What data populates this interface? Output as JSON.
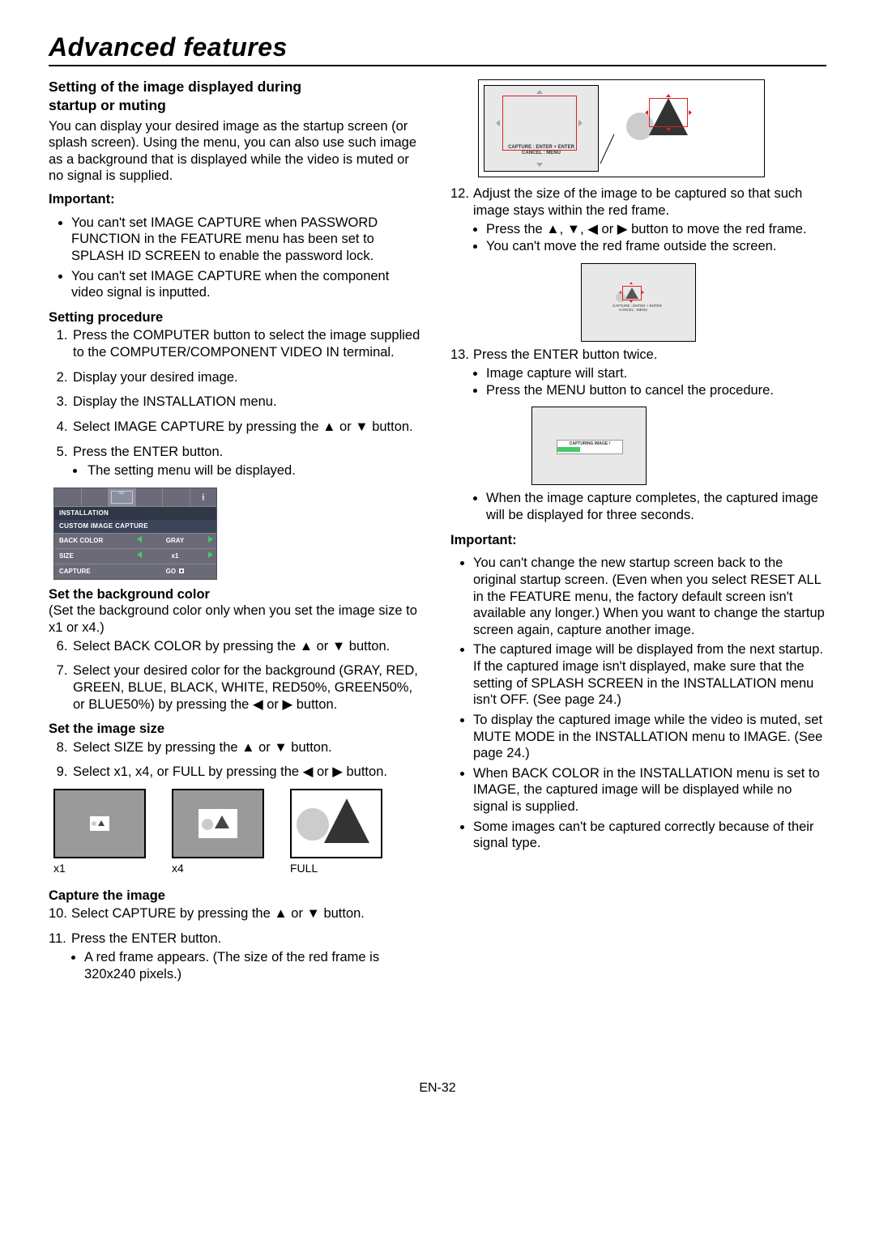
{
  "page_title": "Advanced features",
  "page_number": "EN-32",
  "left": {
    "h2a": "Setting of the image displayed during",
    "h2b": "startup or muting",
    "intro": "You can display your desired image as the startup screen (or splash screen). Using the menu, you can also use such image as a background that is displayed while the video is muted or no signal is supplied.",
    "important_label": "Important:",
    "important": [
      "You can't set IMAGE CAPTURE when PASSWORD FUNCTION in the FEATURE menu has been set to SPLASH ID SCREEN to enable the password lock.",
      "You can't set IMAGE CAPTURE when the component video signal is inputted."
    ],
    "setting_procedure_label": "Setting procedure",
    "steps_1_5": [
      "Press the COMPUTER button to select the image supplied to the COMPUTER/COMPONENT VIDEO IN terminal.",
      "Display your desired image.",
      "Display the INSTALLATION menu.",
      "Select IMAGE CAPTURE by pressing the ▲ or ▼ button.",
      "Press the ENTER button."
    ],
    "step5_sub": "The setting menu will be displayed.",
    "menu": {
      "title1": "INSTALLATION",
      "title2": "CUSTOM IMAGE CAPTURE",
      "rows": [
        {
          "label": "BACK COLOR",
          "val": "GRAY",
          "arrows": true
        },
        {
          "label": "SIZE",
          "val": "x1",
          "arrows": true
        },
        {
          "label": "CAPTURE",
          "val": "GO",
          "arrows": false,
          "go": true
        }
      ],
      "icon_opt": "opt."
    },
    "set_bg_label": "Set the background color",
    "set_bg_note": "(Set the background color only when you set the image size to x1 or x4.)",
    "steps_6_7": [
      "Select BACK COLOR by pressing the ▲ or ▼ button.",
      "Select your desired color for the background (GRAY, RED, GREEN, BLUE, BLACK, WHITE, RED50%, GREEN50%, or BLUE50%) by pressing the ◀ or ▶ button."
    ],
    "set_size_label": "Set the image size",
    "steps_8_9": [
      "Select SIZE by pressing the ▲ or ▼ button.",
      "Select x1, x4, or FULL by pressing the ◀ or ▶ button."
    ],
    "sizes": [
      "x1",
      "x4",
      "FULL"
    ],
    "capture_label": "Capture the image",
    "step10": "Select CAPTURE by pressing the ▲ or ▼ button.",
    "step11": "Press the ENTER button.",
    "step11_sub": "A red frame appears. (The size of the red frame is 320x240 pixels.)"
  },
  "right": {
    "capture_hint1": "CAPTURE : ENTER + ENTER",
    "capture_hint2": "CANCEL : MENU",
    "step12": "Adjust the size of the image to be captured so that such image stays within the red frame.",
    "step12_subs": [
      "Press the ▲, ▼, ◀ or ▶ button to move the red frame.",
      "You can't move the red frame outside the screen."
    ],
    "step13": "Press the ENTER button twice.",
    "step13_subs": [
      "Image capture will start.",
      "Press the MENU button to cancel the procedure."
    ],
    "capturing_label": "CAPTURING IMAGE !",
    "step13_after": "When the image capture completes, the captured image will be displayed for three seconds.",
    "important_label": "Important:",
    "important": [
      "You can't change the new startup screen back to the original startup screen. (Even when you select RESET ALL in the FEATURE menu, the factory default screen isn't available any longer.) When you want to change the startup screen again, capture another image.",
      "The captured image will be displayed from the next startup. If the captured image isn't displayed, make sure that the setting of SPLASH SCREEN in the INSTALLATION menu isn't OFF. (See page 24.)",
      "To display the captured image while the video is muted, set MUTE MODE in the INSTALLATION menu to IMAGE. (See page 24.)",
      "When BACK COLOR in the INSTALLATION menu is set to IMAGE, the captured image will be displayed while no signal is supplied.",
      "Some images can't be captured correctly because of their signal type."
    ]
  }
}
